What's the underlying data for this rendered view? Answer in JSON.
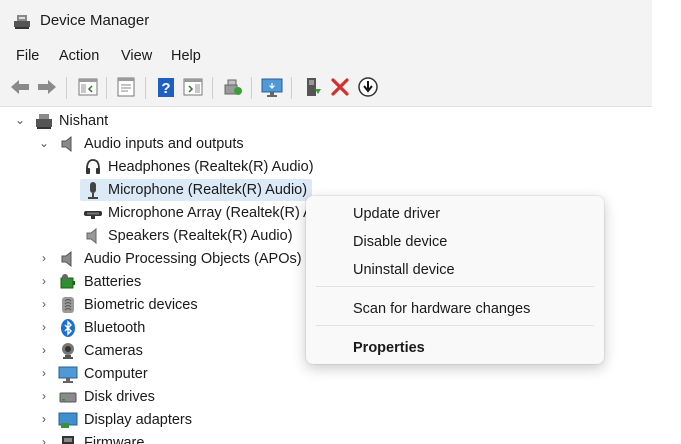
{
  "window": {
    "title": "Device Manager"
  },
  "menubar": {
    "items": [
      "File",
      "Action",
      "View",
      "Help"
    ]
  },
  "toolbar": {
    "buttons": [
      "back-icon",
      "forward-icon",
      "show-hide-console-tree-icon",
      "properties-icon",
      "help-icon",
      "action-pane-icon",
      "scan-hardware-icon",
      "monitor-icon",
      "update-driver-icon",
      "uninstall-device-icon",
      "disable-device-icon"
    ]
  },
  "tree": {
    "root": {
      "label": "Nishant",
      "icon": "computer-root-icon"
    },
    "audio_group": {
      "label": "Audio inputs and outputs",
      "children": [
        {
          "label": "Headphones (Realtek(R) Audio)",
          "icon": "headphones-icon"
        },
        {
          "label": "Microphone (Realtek(R) Audio)",
          "icon": "microphone-icon",
          "selected": true
        },
        {
          "label": "Microphone Array (Realtek(R) A",
          "icon": "microphone-array-icon"
        },
        {
          "label": "Speakers (Realtek(R) Audio)",
          "icon": "speaker-icon"
        }
      ]
    },
    "categories": [
      {
        "label": "Audio Processing Objects (APOs)",
        "icon": "speaker-icon"
      },
      {
        "label": "Batteries",
        "icon": "battery-icon"
      },
      {
        "label": "Biometric devices",
        "icon": "fingerprint-icon"
      },
      {
        "label": "Bluetooth",
        "icon": "bluetooth-icon"
      },
      {
        "label": "Cameras",
        "icon": "camera-icon"
      },
      {
        "label": "Computer",
        "icon": "computer-icon"
      },
      {
        "label": "Disk drives",
        "icon": "disk-drive-icon"
      },
      {
        "label": "Display adapters",
        "icon": "display-adapter-icon"
      },
      {
        "label": "Firmware",
        "icon": "firmware-icon"
      }
    ]
  },
  "context_menu": {
    "items": [
      {
        "label": "Update driver"
      },
      {
        "label": "Disable device"
      },
      {
        "label": "Uninstall device"
      },
      {
        "label": "Scan for hardware changes"
      },
      {
        "label": "Properties",
        "bold": true
      }
    ]
  },
  "colors": {
    "chrome_background": "#f3f3f3",
    "selection": "#dceaf8",
    "uninstall_red": "#d32f2f",
    "help_blue": "#1f5fbf"
  }
}
